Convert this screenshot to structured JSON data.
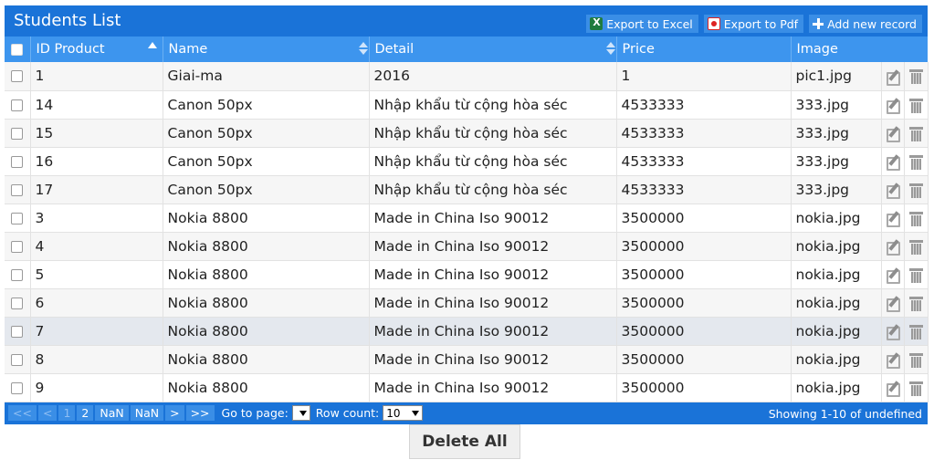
{
  "grid": {
    "title": "Students List",
    "toolbar": {
      "export_excel": "Export to Excel",
      "export_pdf": "Export to Pdf",
      "add_record": "Add new record"
    },
    "columns": [
      "ID Product",
      "Name",
      "Detail",
      "Price",
      "Image"
    ],
    "rows": [
      {
        "id": "1",
        "name": "Giai-ma",
        "detail": "2016",
        "price": "1",
        "image": "pic1.jpg"
      },
      {
        "id": "14",
        "name": "Canon 50px",
        "detail": "Nhập khẩu từ cộng hòa séc",
        "price": "4533333",
        "image": "333.jpg"
      },
      {
        "id": "15",
        "name": "Canon 50px",
        "detail": "Nhập khẩu từ cộng hòa séc",
        "price": "4533333",
        "image": "333.jpg"
      },
      {
        "id": "16",
        "name": "Canon 50px",
        "detail": "Nhập khẩu từ cộng hòa séc",
        "price": "4533333",
        "image": "333.jpg"
      },
      {
        "id": "17",
        "name": "Canon 50px",
        "detail": "Nhập khẩu từ cộng hòa séc",
        "price": "4533333",
        "image": "333.jpg"
      },
      {
        "id": "3",
        "name": "Nokia 8800",
        "detail": "Made in China Iso 90012",
        "price": "3500000",
        "image": "nokia.jpg"
      },
      {
        "id": "4",
        "name": "Nokia 8800",
        "detail": "Made in China Iso 90012",
        "price": "3500000",
        "image": "nokia.jpg"
      },
      {
        "id": "5",
        "name": "Nokia 8800",
        "detail": "Made in China Iso 90012",
        "price": "3500000",
        "image": "nokia.jpg"
      },
      {
        "id": "6",
        "name": "Nokia 8800",
        "detail": "Made in China Iso 90012",
        "price": "3500000",
        "image": "nokia.jpg"
      },
      {
        "id": "7",
        "name": "Nokia 8800",
        "detail": "Made in China Iso 90012",
        "price": "3500000",
        "image": "nokia.jpg"
      },
      {
        "id": "8",
        "name": "Nokia 8800",
        "detail": "Made in China Iso 90012",
        "price": "3500000",
        "image": "nokia.jpg"
      },
      {
        "id": "9",
        "name": "Nokia 8800",
        "detail": "Made in China Iso 90012",
        "price": "3500000",
        "image": "nokia.jpg"
      }
    ],
    "highlighted_row": 9
  },
  "pager": {
    "first": "<<",
    "prev": "<",
    "pages": [
      "1",
      "2",
      "NaN",
      "NaN"
    ],
    "next": ">",
    "last": ">>",
    "goto_label": "Go to page:",
    "goto_value": "",
    "rowcount_label": "Row count:",
    "rowcount_value": "10",
    "info": "Showing 1-10 of undefined"
  },
  "delete_all": "Delete All",
  "icons": {
    "excel": "excel-icon",
    "pdf": "pdf-icon",
    "add": "plus-icon",
    "edit": "edit-icon",
    "delete": "trash-icon"
  },
  "colors": {
    "header_dark": "#1a73d8",
    "header_light": "#3d95ee",
    "row_alt": "#f6f6f6",
    "row_highlight": "#e4e8ee"
  }
}
